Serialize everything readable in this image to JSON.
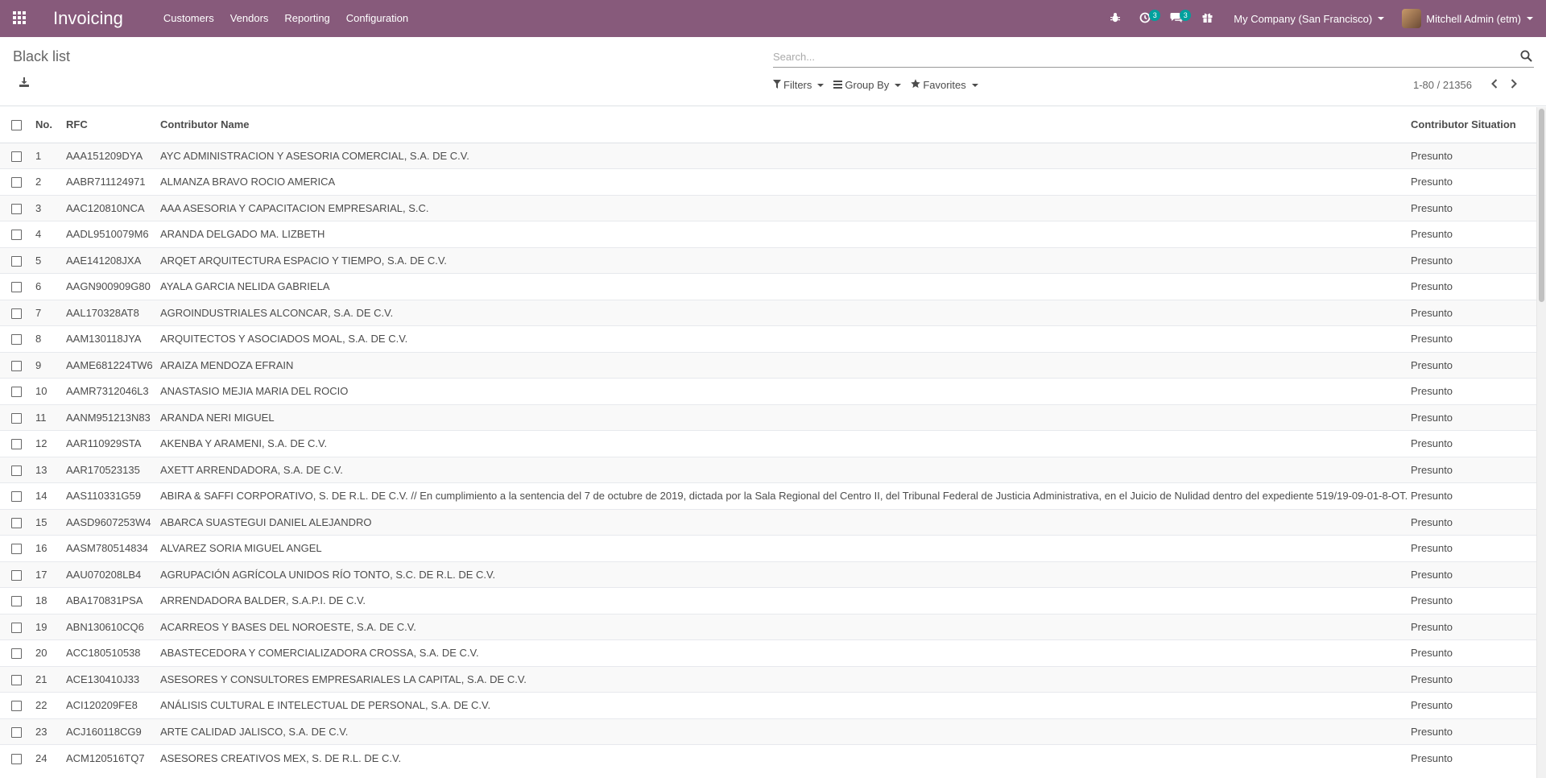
{
  "navbar": {
    "app_title": "Invoicing",
    "menu": [
      "Customers",
      "Vendors",
      "Reporting",
      "Configuration"
    ],
    "activity_count": "3",
    "messages_count": "3",
    "company": "My Company (San Francisco)",
    "user": "Mitchell Admin (etm)",
    "accent": "#875a7b",
    "badge_color": "#00a09d"
  },
  "control_panel": {
    "title": "Black list",
    "search_placeholder": "Search...",
    "filters_label": "Filters",
    "groupby_label": "Group By",
    "favorites_label": "Favorites",
    "pager": "1-80 / 21356"
  },
  "table": {
    "columns": [
      "No.",
      "RFC",
      "Contributor Name",
      "Contributor Situation"
    ],
    "rows": [
      {
        "no": "1",
        "rfc": "AAA151209DYA",
        "name": "AYC ADMINISTRACION Y ASESORIA COMERCIAL, S.A. DE C.V.",
        "situation": "Presunto"
      },
      {
        "no": "2",
        "rfc": "AABR711124971",
        "name": "ALMANZA BRAVO ROCIO AMERICA",
        "situation": "Presunto"
      },
      {
        "no": "3",
        "rfc": "AAC120810NCA",
        "name": "AAA ASESORIA Y CAPACITACION EMPRESARIAL, S.C.",
        "situation": "Presunto"
      },
      {
        "no": "4",
        "rfc": "AADL9510079M6",
        "name": "ARANDA DELGADO MA. LIZBETH",
        "situation": "Presunto"
      },
      {
        "no": "5",
        "rfc": "AAE141208JXA",
        "name": "ARQET ARQUITECTURA ESPACIO Y TIEMPO, S.A. DE C.V.",
        "situation": "Presunto"
      },
      {
        "no": "6",
        "rfc": "AAGN900909G80",
        "name": "AYALA GARCIA NELIDA GABRIELA",
        "situation": "Presunto"
      },
      {
        "no": "7",
        "rfc": "AAL170328AT8",
        "name": "AGROINDUSTRIALES ALCONCAR, S.A. DE C.V.",
        "situation": "Presunto"
      },
      {
        "no": "8",
        "rfc": "AAM130118JYA",
        "name": "ARQUITECTOS Y ASOCIADOS MOAL, S.A. DE C.V.",
        "situation": "Presunto"
      },
      {
        "no": "9",
        "rfc": "AAME681224TW6",
        "name": "ARAIZA MENDOZA EFRAIN",
        "situation": "Presunto"
      },
      {
        "no": "10",
        "rfc": "AAMR7312046L3",
        "name": "ANASTASIO MEJIA MARIA DEL ROCIO",
        "situation": "Presunto"
      },
      {
        "no": "11",
        "rfc": "AANM951213N83",
        "name": "ARANDA NERI MIGUEL",
        "situation": "Presunto"
      },
      {
        "no": "12",
        "rfc": "AAR110929STA",
        "name": "AKENBA Y ARAMENI, S.A. DE C.V.",
        "situation": "Presunto"
      },
      {
        "no": "13",
        "rfc": "AAR170523135",
        "name": "AXETT ARRENDADORA, S.A. DE C.V.",
        "situation": "Presunto"
      },
      {
        "no": "14",
        "rfc": "AAS110331G59",
        "name": "ABIRA & SAFFI CORPORATIVO, S. DE R.L. DE C.V. // En cumplimiento a la sentencia del 7 de octubre de 2019, dictada por la Sala Regional del Centro II, del Tribunal Federal de Justicia Administrativa, en el Juicio de Nulidad dentro del expediente 519/19-09-01-8-OT.",
        "situation": "Presunto"
      },
      {
        "no": "15",
        "rfc": "AASD9607253W4",
        "name": "ABARCA SUASTEGUI DANIEL ALEJANDRO",
        "situation": "Presunto"
      },
      {
        "no": "16",
        "rfc": "AASM780514834",
        "name": "ALVAREZ SORIA MIGUEL ANGEL",
        "situation": "Presunto"
      },
      {
        "no": "17",
        "rfc": "AAU070208LB4",
        "name": "AGRUPACIÓN AGRÍCOLA UNIDOS RÍO TONTO, S.C. DE R.L. DE C.V.",
        "situation": "Presunto"
      },
      {
        "no": "18",
        "rfc": "ABA170831PSA",
        "name": "ARRENDADORA BALDER, S.A.P.I. DE C.V.",
        "situation": "Presunto"
      },
      {
        "no": "19",
        "rfc": "ABN130610CQ6",
        "name": "ACARREOS Y BASES DEL NOROESTE, S.A. DE C.V.",
        "situation": "Presunto"
      },
      {
        "no": "20",
        "rfc": "ACC180510538",
        "name": "ABASTECEDORA Y COMERCIALIZADORA CROSSA, S.A. DE C.V.",
        "situation": "Presunto"
      },
      {
        "no": "21",
        "rfc": "ACE130410J33",
        "name": "ASESORES Y CONSULTORES EMPRESARIALES LA CAPITAL, S.A. DE C.V.",
        "situation": "Presunto"
      },
      {
        "no": "22",
        "rfc": "ACI120209FE8",
        "name": "ANÁLISIS CULTURAL E INTELECTUAL DE PERSONAL, S.A. DE C.V.",
        "situation": "Presunto"
      },
      {
        "no": "23",
        "rfc": "ACJ160118CG9",
        "name": "ARTE CALIDAD JALISCO, S.A. DE C.V.",
        "situation": "Presunto"
      },
      {
        "no": "24",
        "rfc": "ACM120516TQ7",
        "name": "ASESORES CREATIVOS MEX, S. DE R.L. DE C.V.",
        "situation": "Presunto"
      }
    ]
  }
}
